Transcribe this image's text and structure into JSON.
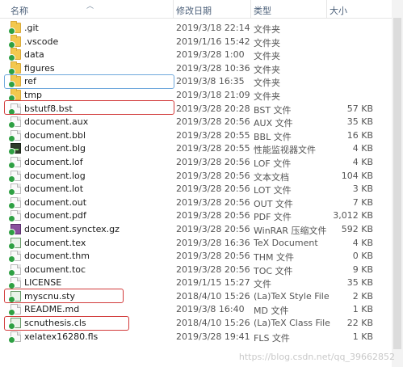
{
  "columns": {
    "name": "名称",
    "date": "修改日期",
    "type": "类型",
    "size": "大小"
  },
  "files": [
    {
      "icon": "folder-icon",
      "name": ".git",
      "date": "2019/3/18 22:14",
      "type": "文件夹",
      "size": ""
    },
    {
      "icon": "folder-icon",
      "name": ".vscode",
      "date": "2019/1/16 15:42",
      "type": "文件夹",
      "size": ""
    },
    {
      "icon": "folder-icon",
      "name": "data",
      "date": "2019/3/28 1:00",
      "type": "文件夹",
      "size": ""
    },
    {
      "icon": "folder-icon",
      "name": "figures",
      "date": "2019/3/28 10:36",
      "type": "文件夹",
      "size": ""
    },
    {
      "icon": "folder-icon",
      "name": "ref",
      "date": "2019/3/8 16:35",
      "type": "文件夹",
      "size": ""
    },
    {
      "icon": "folder-icon",
      "name": "tmp",
      "date": "2019/3/18 21:09",
      "type": "文件夹",
      "size": ""
    },
    {
      "icon": "file-icon",
      "name": "bstutf8.bst",
      "date": "2019/3/28 20:28",
      "type": "BST 文件",
      "size": "57 KB"
    },
    {
      "icon": "file-icon",
      "name": "document.aux",
      "date": "2019/3/28 20:56",
      "type": "AUX 文件",
      "size": "35 KB"
    },
    {
      "icon": "file-icon",
      "name": "document.bbl",
      "date": "2019/3/28 20:55",
      "type": "BBL 文件",
      "size": "16 KB"
    },
    {
      "icon": "perf-log-icon",
      "name": "document.blg",
      "date": "2019/3/28 20:55",
      "type": "性能监视器文件",
      "size": "4 KB"
    },
    {
      "icon": "file-icon",
      "name": "document.lof",
      "date": "2019/3/28 20:56",
      "type": "LOF 文件",
      "size": "4 KB"
    },
    {
      "icon": "file-icon",
      "name": "document.log",
      "date": "2019/3/28 20:56",
      "type": "文本文档",
      "size": "104 KB"
    },
    {
      "icon": "file-icon",
      "name": "document.lot",
      "date": "2019/3/28 20:56",
      "type": "LOT 文件",
      "size": "3 KB"
    },
    {
      "icon": "file-icon",
      "name": "document.out",
      "date": "2019/3/28 20:56",
      "type": "OUT 文件",
      "size": "7 KB"
    },
    {
      "icon": "file-icon",
      "name": "document.pdf",
      "date": "2019/3/28 20:56",
      "type": "PDF 文件",
      "size": "3,012 KB"
    },
    {
      "icon": "archive-icon",
      "name": "document.synctex.gz",
      "date": "2019/3/28 20:56",
      "type": "WinRAR 压缩文件",
      "size": "592 KB"
    },
    {
      "icon": "tex-icon",
      "name": "document.tex",
      "date": "2019/3/28 16:36",
      "type": "TeX Document",
      "size": "4 KB"
    },
    {
      "icon": "file-icon",
      "name": "document.thm",
      "date": "2019/3/28 20:56",
      "type": "THM 文件",
      "size": "0 KB"
    },
    {
      "icon": "file-icon",
      "name": "document.toc",
      "date": "2019/3/28 20:56",
      "type": "TOC 文件",
      "size": "9 KB"
    },
    {
      "icon": "file-icon",
      "name": "LICENSE",
      "date": "2019/1/15 15:27",
      "type": "文件",
      "size": "35 KB"
    },
    {
      "icon": "tex-icon",
      "name": "myscnu.sty",
      "date": "2018/4/10 15:26",
      "type": "(La)TeX Style File",
      "size": "2 KB"
    },
    {
      "icon": "file-icon",
      "name": "README.md",
      "date": "2019/3/8 16:40",
      "type": "MD 文件",
      "size": "1 KB"
    },
    {
      "icon": "tex-icon",
      "name": "scnuthesis.cls",
      "date": "2018/4/10 15:26",
      "type": "(La)TeX Class File",
      "size": "22 KB"
    },
    {
      "icon": "file-icon",
      "name": "xelatex16280.fls",
      "date": "2019/3/28 19:41",
      "type": "FLS 文件",
      "size": "1 KB"
    }
  ],
  "watermark": "https://blog.csdn.net/qq_39662852"
}
